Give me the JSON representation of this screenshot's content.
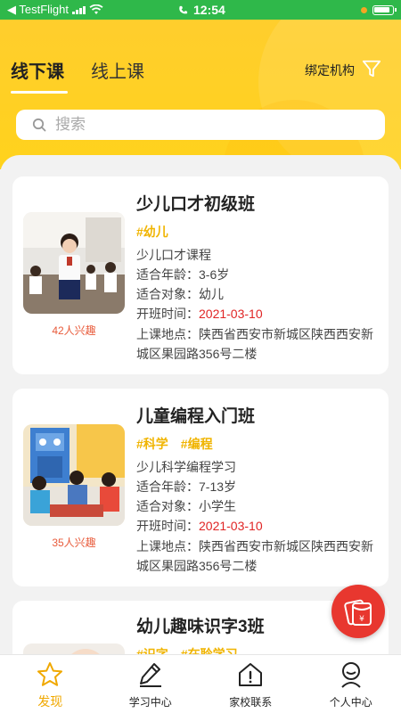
{
  "status_bar": {
    "carrier": "◀ TestFlight",
    "time": "12:54"
  },
  "header": {
    "tabs": [
      {
        "label": "线下课",
        "active": true
      },
      {
        "label": "线上课",
        "active": false
      }
    ],
    "bind_org_label": "绑定机构",
    "filter_icon": "filter-icon"
  },
  "search": {
    "placeholder": "搜索"
  },
  "courses": [
    {
      "title": "少儿口才初级班",
      "tags": [
        "#幼儿"
      ],
      "description": "少儿口才课程",
      "age": "适合年龄：3-6岁",
      "audience": "适合对象：幼儿",
      "start_label": "开班时间：",
      "start_date": "2021-03-10",
      "location": "上课地点：陕西省西安市新城区陕西西安新城区果园路356号二楼",
      "interest": "42人兴趣"
    },
    {
      "title": "儿童编程入门班",
      "tags": [
        "#科学",
        "#编程"
      ],
      "description": "少儿科学编程学习",
      "age": "适合年龄：7-13岁",
      "audience": "适合对象：小学生",
      "start_label": "开班时间：",
      "start_date": "2021-03-10",
      "location": "上课地点：陕西省西安市新城区陕西西安新城区果园路356号二楼",
      "interest": "35人兴趣"
    },
    {
      "title": "幼儿趣味识字3班",
      "tags": [
        "#识字",
        "#在聆学习"
      ]
    }
  ],
  "bottom_nav": [
    {
      "label": "发现",
      "icon": "star-icon",
      "active": true
    },
    {
      "label": "学习中心",
      "icon": "pencil-icon",
      "active": false
    },
    {
      "label": "家校联系",
      "icon": "home-icon",
      "active": false
    },
    {
      "label": "个人中心",
      "icon": "user-icon",
      "active": false
    }
  ],
  "colors": {
    "accent_yellow": "#ffd21c",
    "status_green": "#2fb84a",
    "date_red": "#e02424",
    "tag_yellow": "#f0b400",
    "fab_red": "#e8372f"
  }
}
